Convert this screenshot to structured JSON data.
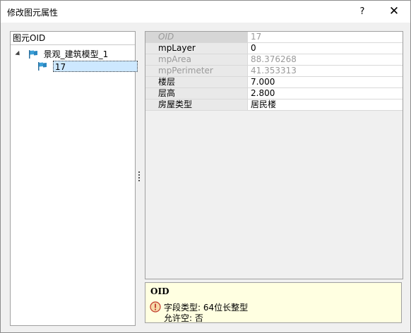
{
  "window": {
    "title": "修改图元属性",
    "help_label": "?",
    "close_label": "✕"
  },
  "tree": {
    "header": "图元OID",
    "root_label": "景观_建筑模型_1",
    "child_label": "17"
  },
  "properties": {
    "rows": [
      {
        "name": "OID",
        "value": "17"
      },
      {
        "name": "mpLayer",
        "value": "0"
      },
      {
        "name": "mpArea",
        "value": "88.376268"
      },
      {
        "name": "mpPerimeter",
        "value": "41.353313"
      },
      {
        "name": "楼层",
        "value": "7.000"
      },
      {
        "name": "层高",
        "value": "2.800"
      },
      {
        "name": "房屋类型",
        "value": "居民楼"
      }
    ]
  },
  "description": {
    "title": "OID",
    "field_type": "字段类型: 64位长整型",
    "nullable": "允许空: 否"
  },
  "colors": {
    "selection": "#cde8ff",
    "info_background": "#ffffe1"
  }
}
